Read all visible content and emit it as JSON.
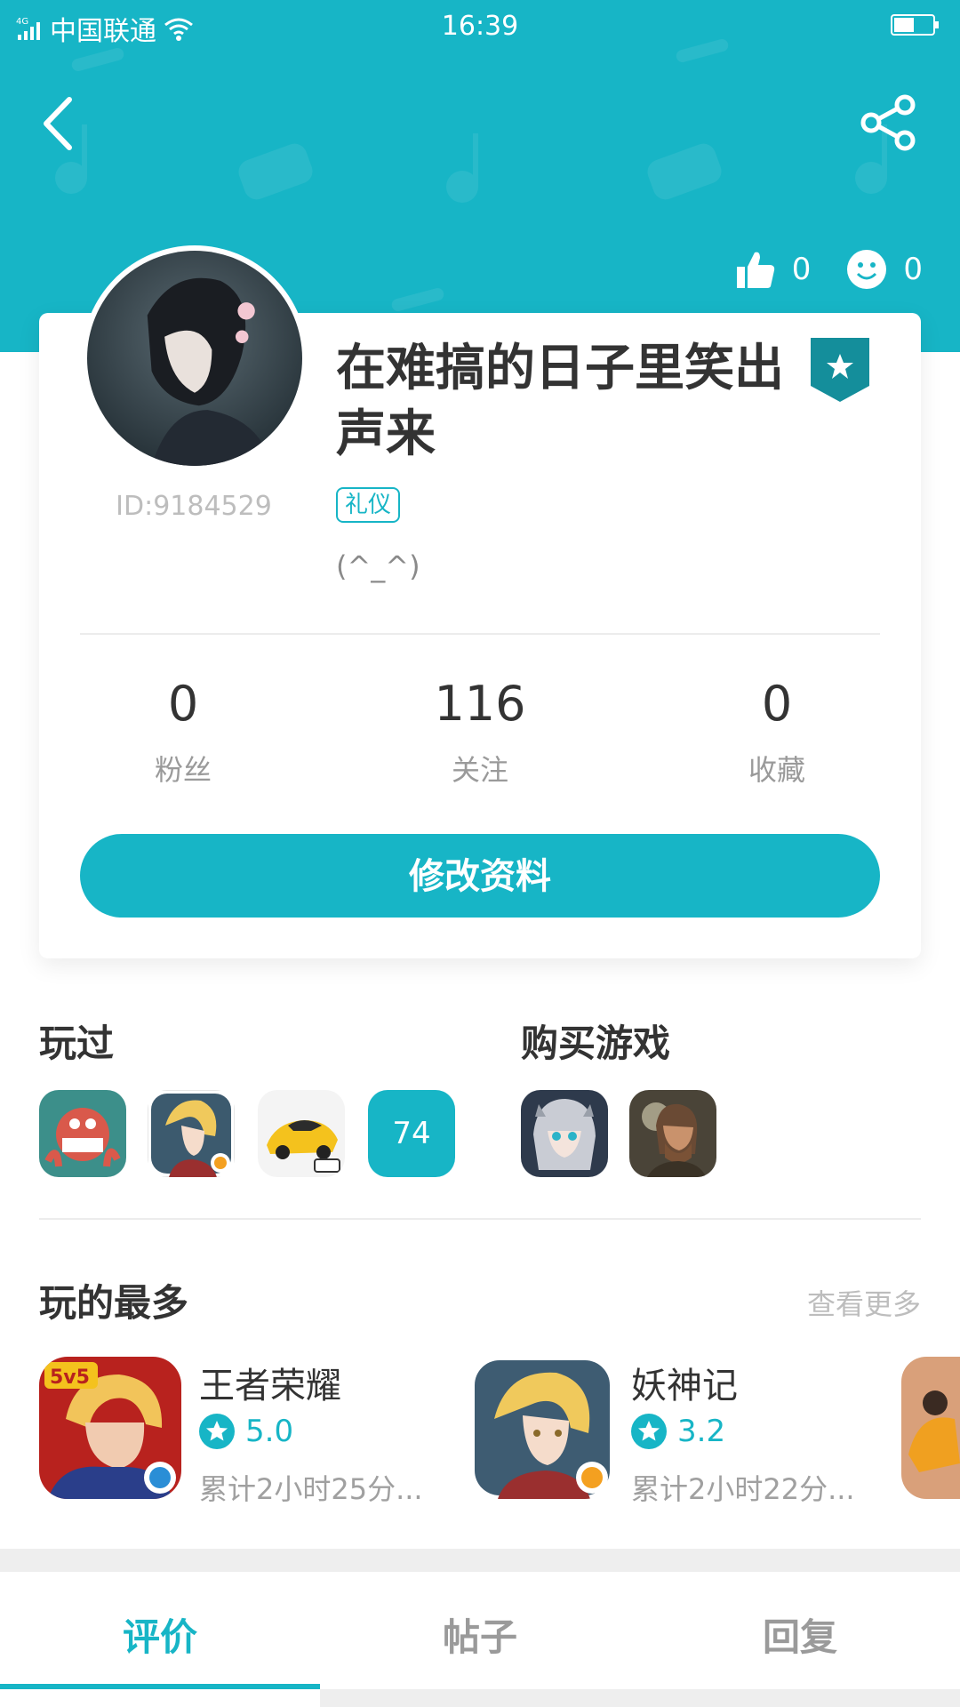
{
  "colors": {
    "accent": "#17b5c6",
    "text": "#333333",
    "muted": "#9a9a9a",
    "light": "#bdbdbd"
  },
  "status_bar": {
    "network": "4G",
    "carrier": "中国联通",
    "time": "16:39"
  },
  "header": {
    "likes": "0",
    "smiles": "0",
    "back_icon": "chevron-left-icon",
    "share_icon": "share-icon"
  },
  "profile": {
    "nickname": "在难搞的日子里笑出声来",
    "user_id": "ID:9184529",
    "tag": "礼仪",
    "signature": "(^_^)",
    "stats": [
      {
        "value": "0",
        "label": "粉丝"
      },
      {
        "value": "116",
        "label": "关注"
      },
      {
        "value": "0",
        "label": "收藏"
      }
    ],
    "edit_button": "修改资料"
  },
  "played": {
    "title": "玩过",
    "more_count": "74"
  },
  "purchased": {
    "title": "购买游戏"
  },
  "most_played": {
    "title": "玩的最多",
    "see_more": "查看更多",
    "games": [
      {
        "name": "王者荣耀",
        "rating": "5.0",
        "time": "累计2小时25分..."
      },
      {
        "name": "妖神记",
        "rating": "3.2",
        "time": "累计2小时22分..."
      }
    ]
  },
  "tabs": [
    {
      "label": "评价",
      "active": true
    },
    {
      "label": "帖子",
      "active": false
    },
    {
      "label": "回复",
      "active": false
    }
  ]
}
